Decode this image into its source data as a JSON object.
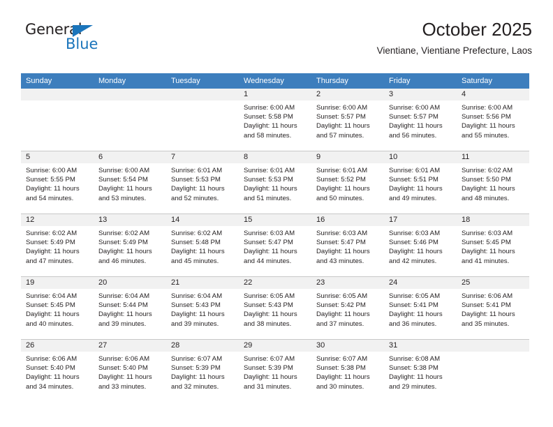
{
  "logo": {
    "word_top": "General",
    "word_bottom": "Blue",
    "triangle_icon": "triangle-icon",
    "brand_color": "#1b75bb"
  },
  "header": {
    "title": "October 2025",
    "subtitle": "Vientiane, Vientiane Prefecture, Laos"
  },
  "theme": {
    "header_bg": "#3d7ebd",
    "header_text": "#ffffff",
    "date_strip_bg": "#f1f1f1",
    "cell_bg": "#ffffff",
    "grid_line": "#c8c8c8",
    "text": "#231f20"
  },
  "weekdays": [
    "Sunday",
    "Monday",
    "Tuesday",
    "Wednesday",
    "Thursday",
    "Friday",
    "Saturday"
  ],
  "weeks": [
    [
      {
        "date": "",
        "sunrise": "",
        "sunset": "",
        "daylight1": "",
        "daylight2": "",
        "empty": true
      },
      {
        "date": "",
        "sunrise": "",
        "sunset": "",
        "daylight1": "",
        "daylight2": "",
        "empty": true
      },
      {
        "date": "",
        "sunrise": "",
        "sunset": "",
        "daylight1": "",
        "daylight2": "",
        "empty": true
      },
      {
        "date": "1",
        "sunrise": "Sunrise: 6:00 AM",
        "sunset": "Sunset: 5:58 PM",
        "daylight1": "Daylight: 11 hours",
        "daylight2": "and 58 minutes."
      },
      {
        "date": "2",
        "sunrise": "Sunrise: 6:00 AM",
        "sunset": "Sunset: 5:57 PM",
        "daylight1": "Daylight: 11 hours",
        "daylight2": "and 57 minutes."
      },
      {
        "date": "3",
        "sunrise": "Sunrise: 6:00 AM",
        "sunset": "Sunset: 5:57 PM",
        "daylight1": "Daylight: 11 hours",
        "daylight2": "and 56 minutes."
      },
      {
        "date": "4",
        "sunrise": "Sunrise: 6:00 AM",
        "sunset": "Sunset: 5:56 PM",
        "daylight1": "Daylight: 11 hours",
        "daylight2": "and 55 minutes."
      }
    ],
    [
      {
        "date": "5",
        "sunrise": "Sunrise: 6:00 AM",
        "sunset": "Sunset: 5:55 PM",
        "daylight1": "Daylight: 11 hours",
        "daylight2": "and 54 minutes."
      },
      {
        "date": "6",
        "sunrise": "Sunrise: 6:00 AM",
        "sunset": "Sunset: 5:54 PM",
        "daylight1": "Daylight: 11 hours",
        "daylight2": "and 53 minutes."
      },
      {
        "date": "7",
        "sunrise": "Sunrise: 6:01 AM",
        "sunset": "Sunset: 5:53 PM",
        "daylight1": "Daylight: 11 hours",
        "daylight2": "and 52 minutes."
      },
      {
        "date": "8",
        "sunrise": "Sunrise: 6:01 AM",
        "sunset": "Sunset: 5:53 PM",
        "daylight1": "Daylight: 11 hours",
        "daylight2": "and 51 minutes."
      },
      {
        "date": "9",
        "sunrise": "Sunrise: 6:01 AM",
        "sunset": "Sunset: 5:52 PM",
        "daylight1": "Daylight: 11 hours",
        "daylight2": "and 50 minutes."
      },
      {
        "date": "10",
        "sunrise": "Sunrise: 6:01 AM",
        "sunset": "Sunset: 5:51 PM",
        "daylight1": "Daylight: 11 hours",
        "daylight2": "and 49 minutes."
      },
      {
        "date": "11",
        "sunrise": "Sunrise: 6:02 AM",
        "sunset": "Sunset: 5:50 PM",
        "daylight1": "Daylight: 11 hours",
        "daylight2": "and 48 minutes."
      }
    ],
    [
      {
        "date": "12",
        "sunrise": "Sunrise: 6:02 AM",
        "sunset": "Sunset: 5:49 PM",
        "daylight1": "Daylight: 11 hours",
        "daylight2": "and 47 minutes."
      },
      {
        "date": "13",
        "sunrise": "Sunrise: 6:02 AM",
        "sunset": "Sunset: 5:49 PM",
        "daylight1": "Daylight: 11 hours",
        "daylight2": "and 46 minutes."
      },
      {
        "date": "14",
        "sunrise": "Sunrise: 6:02 AM",
        "sunset": "Sunset: 5:48 PM",
        "daylight1": "Daylight: 11 hours",
        "daylight2": "and 45 minutes."
      },
      {
        "date": "15",
        "sunrise": "Sunrise: 6:03 AM",
        "sunset": "Sunset: 5:47 PM",
        "daylight1": "Daylight: 11 hours",
        "daylight2": "and 44 minutes."
      },
      {
        "date": "16",
        "sunrise": "Sunrise: 6:03 AM",
        "sunset": "Sunset: 5:47 PM",
        "daylight1": "Daylight: 11 hours",
        "daylight2": "and 43 minutes."
      },
      {
        "date": "17",
        "sunrise": "Sunrise: 6:03 AM",
        "sunset": "Sunset: 5:46 PM",
        "daylight1": "Daylight: 11 hours",
        "daylight2": "and 42 minutes."
      },
      {
        "date": "18",
        "sunrise": "Sunrise: 6:03 AM",
        "sunset": "Sunset: 5:45 PM",
        "daylight1": "Daylight: 11 hours",
        "daylight2": "and 41 minutes."
      }
    ],
    [
      {
        "date": "19",
        "sunrise": "Sunrise: 6:04 AM",
        "sunset": "Sunset: 5:45 PM",
        "daylight1": "Daylight: 11 hours",
        "daylight2": "and 40 minutes."
      },
      {
        "date": "20",
        "sunrise": "Sunrise: 6:04 AM",
        "sunset": "Sunset: 5:44 PM",
        "daylight1": "Daylight: 11 hours",
        "daylight2": "and 39 minutes."
      },
      {
        "date": "21",
        "sunrise": "Sunrise: 6:04 AM",
        "sunset": "Sunset: 5:43 PM",
        "daylight1": "Daylight: 11 hours",
        "daylight2": "and 39 minutes."
      },
      {
        "date": "22",
        "sunrise": "Sunrise: 6:05 AM",
        "sunset": "Sunset: 5:43 PM",
        "daylight1": "Daylight: 11 hours",
        "daylight2": "and 38 minutes."
      },
      {
        "date": "23",
        "sunrise": "Sunrise: 6:05 AM",
        "sunset": "Sunset: 5:42 PM",
        "daylight1": "Daylight: 11 hours",
        "daylight2": "and 37 minutes."
      },
      {
        "date": "24",
        "sunrise": "Sunrise: 6:05 AM",
        "sunset": "Sunset: 5:41 PM",
        "daylight1": "Daylight: 11 hours",
        "daylight2": "and 36 minutes."
      },
      {
        "date": "25",
        "sunrise": "Sunrise: 6:06 AM",
        "sunset": "Sunset: 5:41 PM",
        "daylight1": "Daylight: 11 hours",
        "daylight2": "and 35 minutes."
      }
    ],
    [
      {
        "date": "26",
        "sunrise": "Sunrise: 6:06 AM",
        "sunset": "Sunset: 5:40 PM",
        "daylight1": "Daylight: 11 hours",
        "daylight2": "and 34 minutes."
      },
      {
        "date": "27",
        "sunrise": "Sunrise: 6:06 AM",
        "sunset": "Sunset: 5:40 PM",
        "daylight1": "Daylight: 11 hours",
        "daylight2": "and 33 minutes."
      },
      {
        "date": "28",
        "sunrise": "Sunrise: 6:07 AM",
        "sunset": "Sunset: 5:39 PM",
        "daylight1": "Daylight: 11 hours",
        "daylight2": "and 32 minutes."
      },
      {
        "date": "29",
        "sunrise": "Sunrise: 6:07 AM",
        "sunset": "Sunset: 5:39 PM",
        "daylight1": "Daylight: 11 hours",
        "daylight2": "and 31 minutes."
      },
      {
        "date": "30",
        "sunrise": "Sunrise: 6:07 AM",
        "sunset": "Sunset: 5:38 PM",
        "daylight1": "Daylight: 11 hours",
        "daylight2": "and 30 minutes."
      },
      {
        "date": "31",
        "sunrise": "Sunrise: 6:08 AM",
        "sunset": "Sunset: 5:38 PM",
        "daylight1": "Daylight: 11 hours",
        "daylight2": "and 29 minutes."
      },
      {
        "date": "",
        "sunrise": "",
        "sunset": "",
        "daylight1": "",
        "daylight2": "",
        "empty": true
      }
    ]
  ]
}
